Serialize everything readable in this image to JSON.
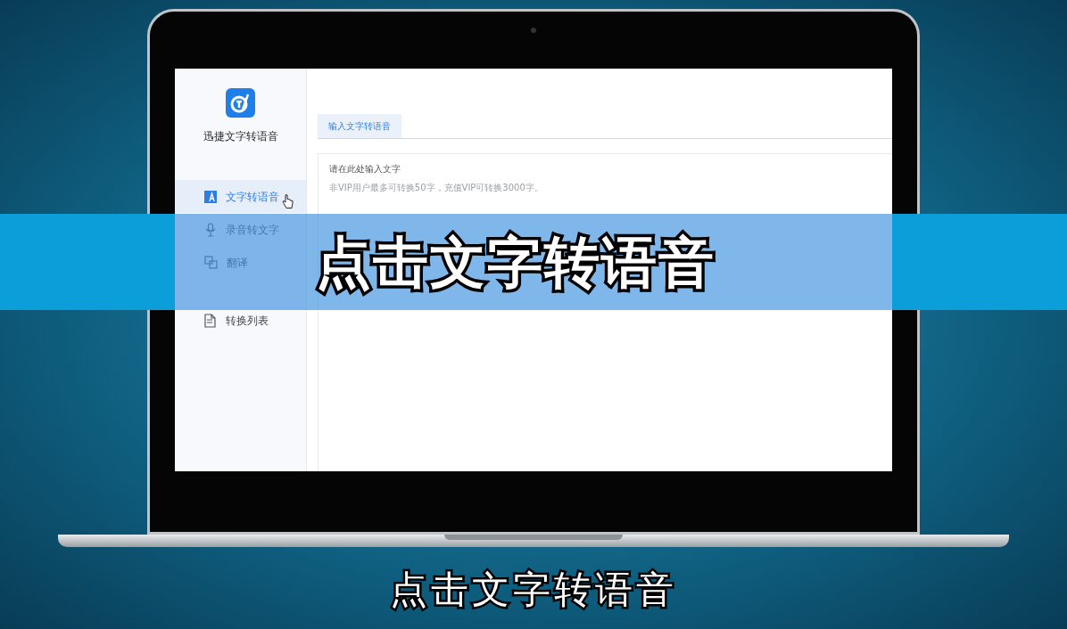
{
  "app": {
    "name": "迅捷文字转语音",
    "nav": [
      {
        "label": "文字转语音",
        "kind": "text",
        "selected": true
      },
      {
        "label": "录音转文字",
        "kind": "mic",
        "selected": false
      },
      {
        "label": "翻译",
        "kind": "translate",
        "selected": false
      },
      {
        "label": "转换列表",
        "kind": "list",
        "selected": false
      }
    ],
    "tabs": [
      {
        "label": "输入文字转语音",
        "selected": true
      }
    ],
    "editor": {
      "placeholder": "请在此处输入文字",
      "hint": "非VIP用户最多可转换50字，充值VIP可转换3000字。"
    }
  },
  "caption_band": {
    "text": "点击文字转语音"
  },
  "subtitle": "点击文字转语音"
}
